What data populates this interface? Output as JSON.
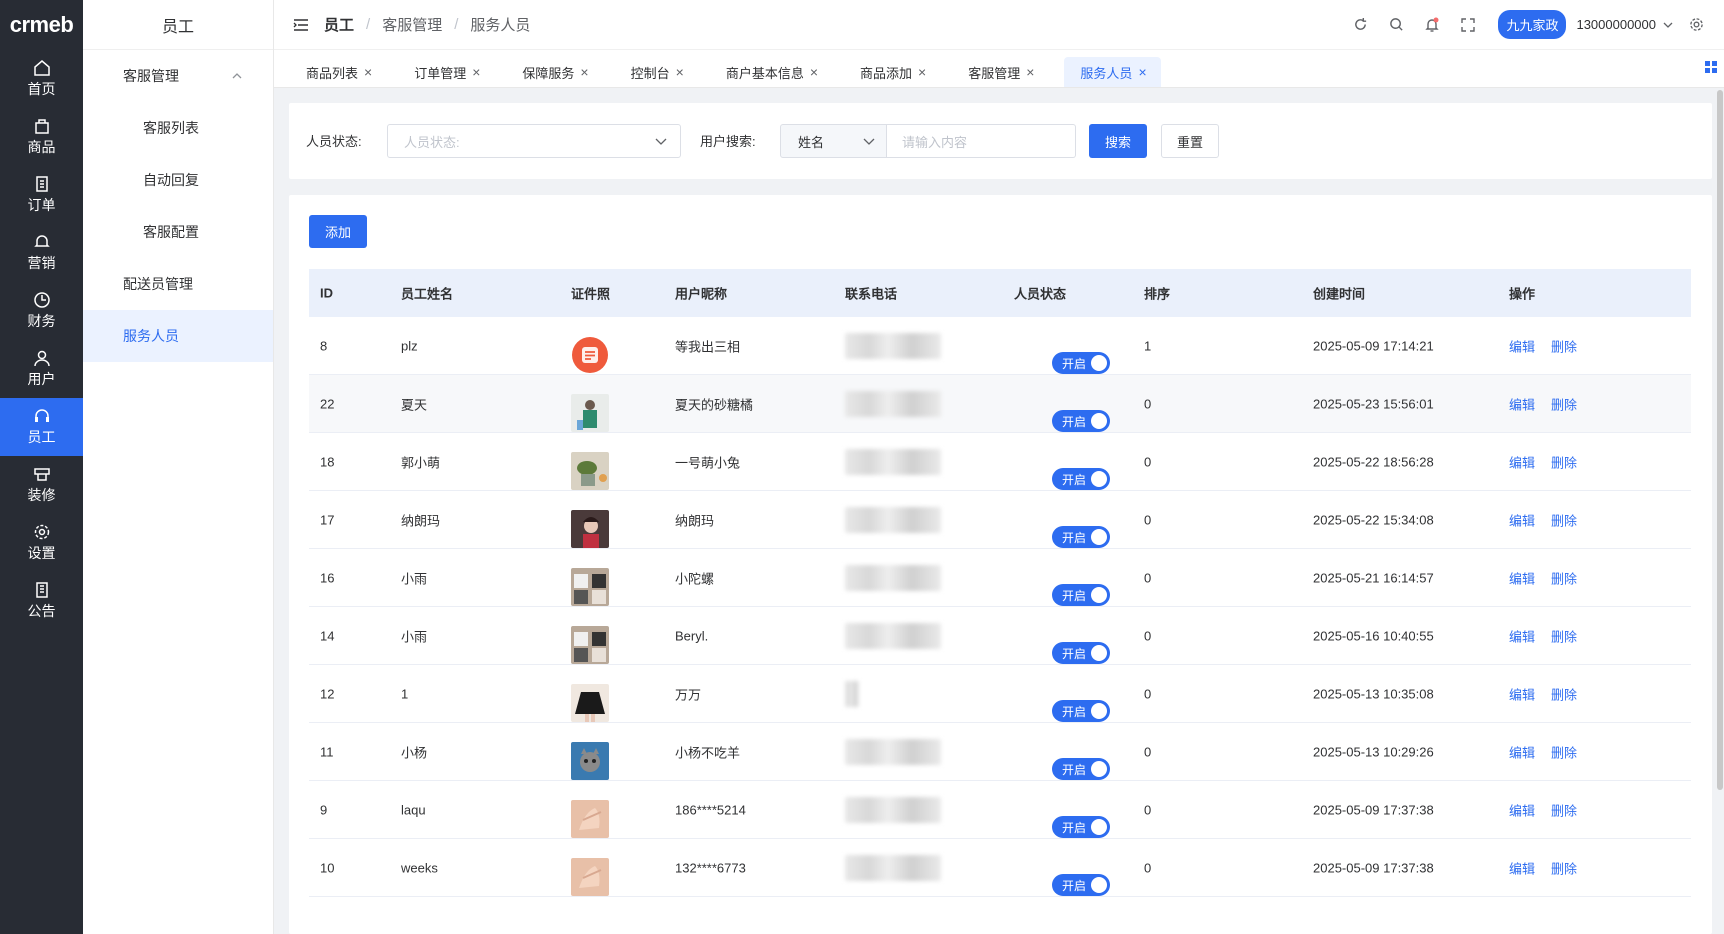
{
  "logo": "crmeb",
  "rail": [
    {
      "label": "首页",
      "icon": "home-icon"
    },
    {
      "label": "商品",
      "icon": "product-icon"
    },
    {
      "label": "订单",
      "icon": "order-icon"
    },
    {
      "label": "营销",
      "icon": "marketing-icon"
    },
    {
      "label": "财务",
      "icon": "finance-icon"
    },
    {
      "label": "用户",
      "icon": "user-icon"
    },
    {
      "label": "员工",
      "icon": "headset-icon"
    },
    {
      "label": "装修",
      "icon": "decorate-icon"
    },
    {
      "label": "设置",
      "icon": "settings-icon"
    },
    {
      "label": "公告",
      "icon": "notice-icon"
    }
  ],
  "submenu": {
    "title": "员工",
    "group": "客服管理",
    "group_items": [
      "客服列表",
      "自动回复",
      "客服配置"
    ],
    "item_delivery": "配送员管理",
    "item_service": "服务人员"
  },
  "header": {
    "crumb1": "员工",
    "crumb2": "客服管理",
    "crumb3": "服务人员",
    "merchant": "九九家政",
    "account": "13000000000"
  },
  "tabs": [
    "商品列表",
    "订单管理",
    "保障服务",
    "控制台",
    "商户基本信息",
    "商品添加",
    "客服管理",
    "服务人员"
  ],
  "filter": {
    "status_label": "人员状态:",
    "status_placeholder": "人员状态:",
    "search_label": "用户搜索:",
    "search_type": "姓名",
    "search_placeholder": "请输入内容",
    "search_button": "搜索",
    "reset_button": "重置"
  },
  "add_button": "添加",
  "table": {
    "headers": [
      "ID",
      "员工姓名",
      "证件照",
      "用户昵称",
      "联系电话",
      "人员状态",
      "排序",
      "创建时间",
      "操作"
    ],
    "status_label": "开启",
    "op_edit": "编辑",
    "op_delete": "删除",
    "rows": [
      {
        "id": "8",
        "name": "plz",
        "nick": "等我出三相",
        "sort": "1",
        "time": "2025-05-09 17:14:21",
        "photo": "orange-logo",
        "phone_short": false
      },
      {
        "id": "22",
        "name": "夏天",
        "nick": "夏天的砂糖橘",
        "sort": "0",
        "time": "2025-05-23 15:56:01",
        "photo": "person",
        "phone_short": false
      },
      {
        "id": "18",
        "name": "郭小萌",
        "nick": "一号萌小兔",
        "sort": "0",
        "time": "2025-05-22 18:56:28",
        "photo": "plant",
        "phone_short": false
      },
      {
        "id": "17",
        "name": "纳朗玛",
        "nick": "纳朗玛",
        "sort": "0",
        "time": "2025-05-22 15:34:08",
        "photo": "kid",
        "phone_short": false
      },
      {
        "id": "16",
        "name": "小雨",
        "nick": "小陀螺",
        "sort": "0",
        "time": "2025-05-21 16:14:57",
        "photo": "group",
        "phone_short": false
      },
      {
        "id": "14",
        "name": "小雨",
        "nick": "Beryl.",
        "sort": "0",
        "time": "2025-05-16 10:40:55",
        "photo": "group",
        "phone_short": false
      },
      {
        "id": "12",
        "name": "1",
        "nick": "万万",
        "sort": "0",
        "time": "2025-05-13 10:35:08",
        "photo": "skirt",
        "phone_short": true
      },
      {
        "id": "11",
        "name": "小杨",
        "nick": "小杨不吃羊",
        "sort": "0",
        "time": "2025-05-13 10:29:26",
        "photo": "cat",
        "phone_short": false
      },
      {
        "id": "9",
        "name": "laqu",
        "nick": "186****5214",
        "sort": "0",
        "time": "2025-05-09 17:37:38",
        "photo": "hand",
        "phone_short": false
      },
      {
        "id": "10",
        "name": "weeks",
        "nick": "132****6773",
        "sort": "0",
        "time": "2025-05-09 17:37:38",
        "photo": "hand",
        "phone_short": false
      }
    ]
  },
  "colors": {
    "primary": "#2d6cf0",
    "rail_bg": "#282c34",
    "header_row": "#eaf0fb"
  }
}
